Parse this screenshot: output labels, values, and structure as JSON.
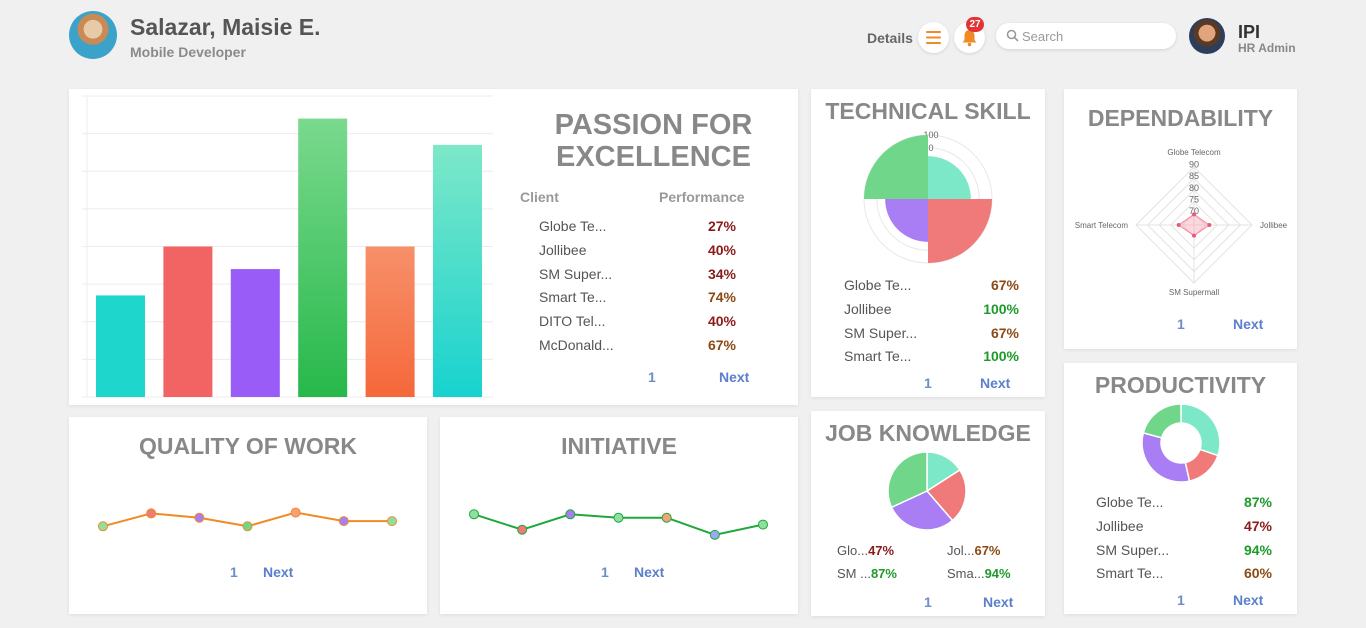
{
  "header": {
    "user_name": "Salazar, Maisie E.",
    "user_role": "Mobile Developer",
    "details_label": "Details",
    "menu_icon": "hamburger-icon",
    "bell_icon": "bell-icon",
    "notification_count": "27",
    "search_placeholder": "Search",
    "admin_name": "IPI",
    "admin_role": "HR Admin"
  },
  "colors": {
    "teal": "#1fd6cc",
    "red": "#f26464",
    "purple": "#9a5cf6",
    "green": "#33bf5c",
    "orange": "#f57b4a",
    "mint": "#7de8c8",
    "pie_green": "#6fd68a",
    "pie_red": "#f07a7a",
    "pie_purple": "#a97ef5"
  },
  "passion": {
    "title_line1": "PASSION FOR",
    "title_line2": "EXCELLENCE",
    "col_client": "Client",
    "col_performance": "Performance",
    "rows": [
      {
        "client": "Globe Te...",
        "value": "27%"
      },
      {
        "client": "Jollibee",
        "value": "40%"
      },
      {
        "client": "SM Super...",
        "value": "34%"
      },
      {
        "client": "Smart Te...",
        "value": "74%"
      },
      {
        "client": "DITO Tel...",
        "value": "40%"
      },
      {
        "client": "McDonald...",
        "value": "67%"
      }
    ],
    "page": "1",
    "next": "Next"
  },
  "technical": {
    "title": "TECHNICAL SKILL",
    "rows": [
      {
        "client": "Globe Te...",
        "value": "67%"
      },
      {
        "client": "Jollibee",
        "value": "100%"
      },
      {
        "client": "SM Super...",
        "value": "67%"
      },
      {
        "client": "Smart Te...",
        "value": "100%"
      }
    ],
    "page": "1",
    "next": "Next"
  },
  "dependability": {
    "title": "DEPENDABILITY",
    "page": "1",
    "next": "Next"
  },
  "productivity": {
    "title": "PRODUCTIVITY",
    "rows": [
      {
        "client": "Globe Te...",
        "value": "87%"
      },
      {
        "client": "Jollibee",
        "value": "47%"
      },
      {
        "client": "SM Super...",
        "value": "94%"
      },
      {
        "client": "Smart Te...",
        "value": "60%"
      }
    ],
    "page": "1",
    "next": "Next"
  },
  "quality": {
    "title": "QUALITY OF WORK",
    "page": "1",
    "next": "Next"
  },
  "initiative": {
    "title": "INITIATIVE",
    "page": "1",
    "next": "Next"
  },
  "job": {
    "title": "JOB KNOWLEDGE",
    "items": [
      {
        "client": "Glo...",
        "value": "47%"
      },
      {
        "client": "Jol...",
        "value": "67%"
      },
      {
        "client": "SM ...",
        "value": "87%"
      },
      {
        "client": "Sma...",
        "value": "94%"
      }
    ],
    "page": "1",
    "next": "Next"
  },
  "chart_data": [
    {
      "type": "bar",
      "categories": [
        "Globe Telecom",
        "Jollibee",
        "SM Supermall",
        "Smart Telecom",
        "DITO Telecom",
        "McDonald's"
      ],
      "values": [
        27,
        40,
        34,
        74,
        40,
        67
      ],
      "ylim": [
        0,
        80
      ],
      "grid": true
    },
    {
      "type": "polar-area",
      "categories": [
        "Globe Telecom",
        "Jollibee",
        "SM Supermall",
        "Smart Telecom"
      ],
      "values": [
        67,
        100,
        67,
        100
      ],
      "tick_labels": [
        "100",
        "0"
      ]
    },
    {
      "type": "radar",
      "categories": [
        "Globe Telecom",
        "Jollibee",
        "SM Supermall",
        "Smart Telecom"
      ],
      "values": [
        70,
        72,
        70,
        72
      ],
      "tick_labels": [
        "70",
        "75",
        "80",
        "85",
        "90"
      ],
      "range": [
        70,
        90
      ]
    },
    {
      "type": "doughnut",
      "categories": [
        "Globe Telecom",
        "Jollibee",
        "SM Supermall",
        "Smart Telecom"
      ],
      "values": [
        87,
        47,
        94,
        60
      ]
    },
    {
      "type": "line",
      "values": [
        30,
        45,
        40,
        30,
        46,
        36,
        36
      ],
      "ylim": [
        0,
        70
      ]
    },
    {
      "type": "line",
      "values": [
        44,
        26,
        44,
        40,
        40,
        20,
        32
      ],
      "ylim": [
        0,
        70
      ]
    },
    {
      "type": "pie",
      "categories": [
        "Globe Telecom",
        "Jollibee",
        "SM Supermall",
        "Smart Telecom"
      ],
      "values": [
        47,
        67,
        87,
        94
      ]
    }
  ]
}
